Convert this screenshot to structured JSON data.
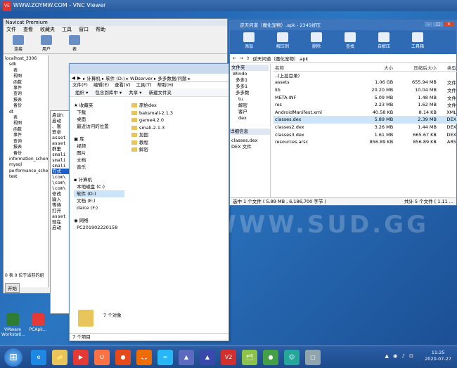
{
  "vnc": {
    "title": "WWW.ZOYMW.COM - VNC Viewer",
    "logo": "VE"
  },
  "watermark": "WWW.SUD.GG",
  "navicat": {
    "title": "Navicat Premium",
    "menu": [
      "文件",
      "查看",
      "收藏夹",
      "工具",
      "窗口",
      "帮助"
    ],
    "tools": [
      "连接",
      "用户",
      "表"
    ],
    "tree": [
      "localhost_3306",
      "sdk",
      "表",
      "视图",
      "函数",
      "事件",
      "查询",
      "报表",
      "备份",
      "dt",
      "表",
      "视图",
      "函数",
      "事件",
      "查询",
      "报表",
      "备份",
      "information_schema",
      "mysql",
      "performance_schema",
      "test"
    ],
    "terminal": [
      "启动\\",
      "启动",
      "",
      "",
      "、客",
      "",
      "安卓",
      "asset",
      "asset",
      "群里",
      "smali",
      "smali",
      "smali",
      "",
      "方式",
      "",
      "",
      "",
      "",
      "\\com\\",
      "\\com\\",
      "\\com\\",
      "修改",
      "输入",
      "等待",
      "",
      "",
      "打开",
      "",
      "asset",
      "",
      "",
      "现在",
      "启动"
    ],
    "status": "0 表 0 位于当前的组",
    "start_label": "开始"
  },
  "explorer": {
    "breadcrumb": "▸ 计算机 ▸ 软件 (D:) ▸ WDserver ▸ 多多数据/问题 ▸",
    "menu": [
      "文件(F)",
      "编辑(E)",
      "查看(V)",
      "工具(T)",
      "帮助(H)"
    ],
    "cmd": [
      "组织 ▾",
      "包含到库中 ▾",
      "共享 ▾",
      "新建文件夹"
    ],
    "favorites_title": "收藏夹",
    "favorites": [
      "下载",
      "桌面",
      "最近访问的位置"
    ],
    "library_title": "库",
    "libraries": [
      "视频",
      "图片",
      "文档",
      "音乐"
    ],
    "computer_title": "计算机",
    "drives": [
      "本地磁盘 (C:)",
      "软件 (D:)",
      "文档 (E:)",
      "daice (F:)"
    ],
    "network_title": "网络",
    "network_items": [
      "PC201902220158"
    ],
    "files": [
      "原始dex",
      "baksmali-2.1.3",
      "game4.2.0",
      "smali-2.1.3",
      "加固",
      "教程",
      "解密"
    ],
    "count": "7 个对象",
    "status": "7 个项目"
  },
  "archive": {
    "title": "逆天问道（魔化宠物）.apk - 2345好压",
    "tools": [
      "添加",
      "解压到",
      "删除",
      "查找",
      "自解压",
      "工具箱"
    ],
    "path": "逆天问道（魔化宠物）.apk",
    "tree_title": "文件夹",
    "tree": [
      "Windo",
      "多多1",
      "多多1",
      "多多数",
      "tu",
      "解密",
      "客户",
      "dex"
    ],
    "details_title": "详细信息",
    "details": [
      "classes.dex",
      "DEX 文件"
    ],
    "headers": {
      "name": "名称",
      "size": "大小",
      "packed": "压缩后大小",
      "type": "类型"
    },
    "rows": [
      {
        "name": "..(上层目录)",
        "size": "",
        "packed": "",
        "type": ""
      },
      {
        "name": "assets",
        "size": "1.06 GB",
        "packed": "655.94 MB",
        "type": "文件"
      },
      {
        "name": "lib",
        "size": "20.20 MB",
        "packed": "10.04 MB",
        "type": "文件"
      },
      {
        "name": "META-INF",
        "size": "5.09 MB",
        "packed": "1.48 MB",
        "type": "文件"
      },
      {
        "name": "res",
        "size": "2.23 MB",
        "packed": "1.62 MB",
        "type": "文件"
      },
      {
        "name": "AndroidManifest.xml",
        "size": "40.58 KB",
        "packed": "8.14 KB",
        "type": "XML"
      },
      {
        "name": "classes.dex",
        "size": "5.89 MB",
        "packed": "2.39 MB",
        "type": "DEX"
      },
      {
        "name": "classes2.dex",
        "size": "3.26 MB",
        "packed": "1.44 MB",
        "type": "DEX"
      },
      {
        "name": "classes3.dex",
        "size": "1.61 MB",
        "packed": "665.67 KB",
        "type": "DEX"
      },
      {
        "name": "resources.arsc",
        "size": "856.89 KB",
        "packed": "856.89 KB",
        "type": "ARS"
      }
    ],
    "status_left": "选中 1 个文件 ( 5.89 MB , 6,186,700 字节 )",
    "status_right": "共计 5 个文件 ( 1.11 ..."
  },
  "desktop_icons": [
    "VMware Workstati...",
    "PCApk..."
  ],
  "taskbar": {
    "apps": [
      "e",
      "📁",
      "▶",
      "O",
      "●",
      "🦊",
      "∞",
      "▲",
      "▲",
      "V2",
      "🗂",
      "●",
      "☺",
      "□"
    ],
    "colors": [
      "#1e88e5",
      "#e9c45a",
      "#e53935",
      "#ff7043",
      "#e64a19",
      "#ef6c00",
      "#29b6f6",
      "#5c6bc0",
      "#3949ab",
      "#d32f2f",
      "#8bc34a",
      "#43a047",
      "#26a69a",
      "#90a4ae"
    ],
    "time": "11:25",
    "date": "2020-07-27"
  }
}
